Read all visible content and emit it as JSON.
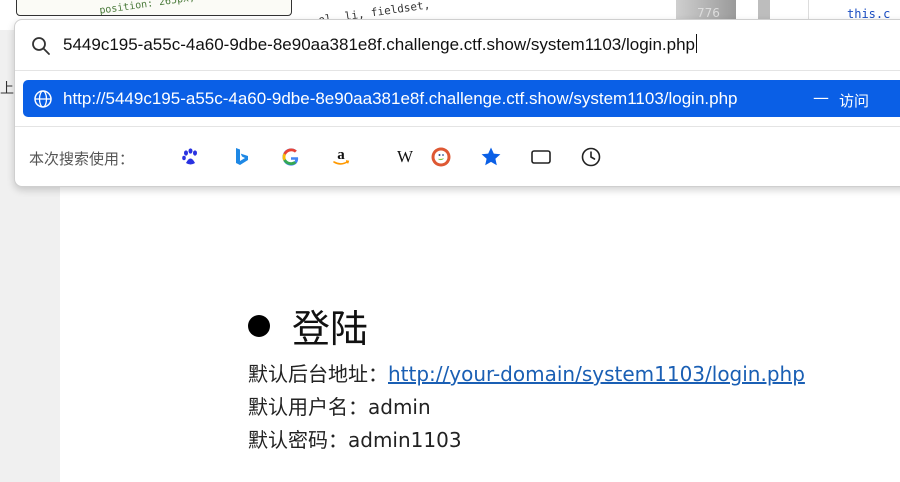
{
  "background": {
    "code_snippet_left": "position: 265px;",
    "code_snippet_mid": "ol, li, fieldset,",
    "number_badge": "776",
    "code_snippet_right": "this.c",
    "side_char": "上"
  },
  "address_bar": {
    "url_value": "5449c195-a55c-4a60-9dbe-8e90aa381e8f.challenge.ctf.show/system1103/login.php"
  },
  "suggestion": {
    "url": "http://5449c195-a55c-4a60-9dbe-8e90aa381e8f.challenge.ctf.show/system1103/login.php",
    "separator": "—",
    "action": "访问"
  },
  "search_engines": {
    "label": "本次搜索使用：",
    "engines": [
      {
        "name": "baidu",
        "icon": "baidu-icon"
      },
      {
        "name": "bing",
        "icon": "bing-icon"
      },
      {
        "name": "google",
        "icon": "google-icon"
      },
      {
        "name": "amazon",
        "icon": "amazon-icon"
      },
      {
        "name": "wikipedia",
        "icon": "wikipedia-icon"
      },
      {
        "name": "duckduckgo",
        "icon": "duckduckgo-icon"
      },
      {
        "name": "bookmarks",
        "icon": "star-icon"
      },
      {
        "name": "tabs",
        "icon": "tab-icon"
      },
      {
        "name": "history",
        "icon": "clock-icon"
      }
    ]
  },
  "page": {
    "heading": "登陆",
    "backend_label": "默认后台地址：",
    "backend_link": "http://your-domain/system1103/login.php",
    "username_label": "默认用户名：",
    "username_value": "admin",
    "password_label": "默认密码：",
    "password_value": "admin1103"
  },
  "colors": {
    "accent": "#0a5fe6",
    "link": "#1a5fb4"
  }
}
